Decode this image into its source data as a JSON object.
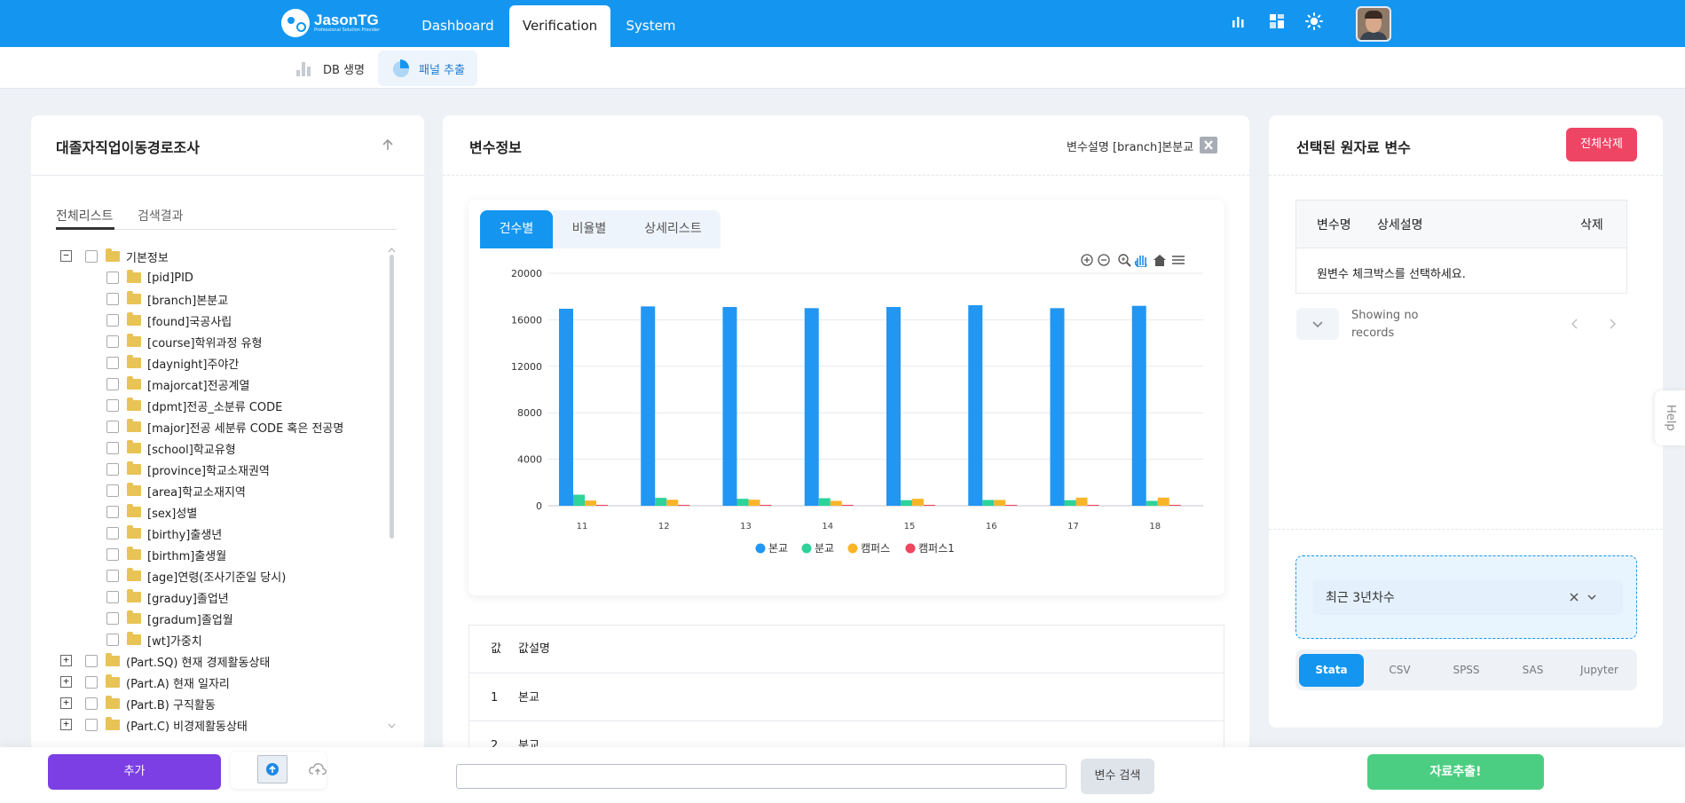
{
  "header": {
    "logo_name": "JasonTG",
    "logo_sub": "Professional Solution Provider",
    "tabs": [
      {
        "label": "Dashboard",
        "active": false
      },
      {
        "label": "Verification",
        "active": true
      },
      {
        "label": "System",
        "active": false
      }
    ],
    "icons": [
      "bar-chart-icon",
      "grid-icon",
      "sun-icon"
    ]
  },
  "subnav": {
    "items": [
      {
        "label": "DB 생명",
        "icon": "bar-chart-icon",
        "active": false
      },
      {
        "label": "패널 추출",
        "icon": "pie-chart-icon",
        "active": true
      }
    ]
  },
  "left": {
    "title": "대졸자직업이동경로조사",
    "tabs": [
      "전체리스트",
      "검색결과"
    ],
    "root": {
      "label": "기본정보",
      "expander": "−"
    },
    "items": [
      "[pid]PID",
      "[branch]본분교",
      "[found]국공사립",
      "[course]학위과정 유형",
      "[daynight]주야간",
      "[majorcat]전공계열",
      "[dpmt]전공_소분류 CODE",
      "[major]전공 세분류 CODE 혹은 전공명",
      "[school]학교유형",
      "[province]학교소재권역",
      "[area]학교소재지역",
      "[sex]성별",
      "[birthy]출생년",
      "[birthm]출생월",
      "[age]연령(조사기준일 당시)",
      "[graduy]졸업년",
      "[gradum]졸업월",
      "[wt]가중치"
    ],
    "groups": [
      "(Part.SQ) 현재 경제활동상태",
      "(Part.A) 현재 일자리",
      "(Part.B) 구직활동",
      "(Part.C) 비경제활동상태"
    ],
    "group_expander": "+"
  },
  "middle": {
    "title": "변수정보",
    "desc": "변수설명 [branch]본분교",
    "tabs": [
      {
        "label": "건수별",
        "active": true
      },
      {
        "label": "비율별",
        "active": false
      },
      {
        "label": "상세리스트",
        "active": false
      }
    ],
    "table_header": {
      "value": "값",
      "label": "값설명"
    },
    "table_rows": [
      {
        "value": "1",
        "label": "본교"
      },
      {
        "value": "2",
        "label": "분교"
      }
    ]
  },
  "chart_data": {
    "type": "bar",
    "categories": [
      "11",
      "12",
      "13",
      "14",
      "15",
      "16",
      "17",
      "18"
    ],
    "ylim": [
      0,
      20000
    ],
    "yticks": [
      0,
      4000,
      8000,
      12000,
      16000,
      20000
    ],
    "grid": true,
    "legend_placement": "bottom",
    "series": [
      {
        "name": "본교",
        "color": "#2196f3",
        "values": [
          16950,
          17150,
          17100,
          17000,
          17100,
          17250,
          17000,
          17200
        ]
      },
      {
        "name": "분교",
        "color": "#2ed39a",
        "values": [
          950,
          680,
          600,
          650,
          480,
          500,
          480,
          420
        ]
      },
      {
        "name": "캠퍼스",
        "color": "#f9b52a",
        "values": [
          450,
          520,
          520,
          420,
          600,
          500,
          700,
          700
        ]
      },
      {
        "name": "캠퍼스1",
        "color": "#f0465e",
        "values": [
          80,
          80,
          80,
          80,
          80,
          80,
          80,
          80
        ]
      }
    ]
  },
  "chart_toolbar": [
    "zoom-in-icon",
    "zoom-out-icon",
    "magnifier-icon",
    "pan-hand-icon",
    "home-icon",
    "menu-icon"
  ],
  "right": {
    "title": "선택된 원자료 변수",
    "delete_all": "전체삭제",
    "columns": {
      "name": "변수명",
      "desc": "상세설명",
      "delete": "삭제"
    },
    "empty_message": "원변수 체크박스를 선택하세요.",
    "records": "Showing no records",
    "filter_value": "최근 3년차수",
    "formats": [
      {
        "label": "Stata",
        "active": true
      },
      {
        "label": "CSV",
        "active": false
      },
      {
        "label": "SPSS",
        "active": false
      },
      {
        "label": "SAS",
        "active": false
      },
      {
        "label": "Jupyter",
        "active": false
      }
    ]
  },
  "bottom": {
    "add_label": "추가",
    "search_placeholder": "",
    "search_button": "변수 검색",
    "extract_button": "자료추출!"
  },
  "help": "Help",
  "colors": {
    "primary": "#1496f0",
    "danger": "#ef4565",
    "purple": "#7b3fe4",
    "green": "#4cce82"
  }
}
